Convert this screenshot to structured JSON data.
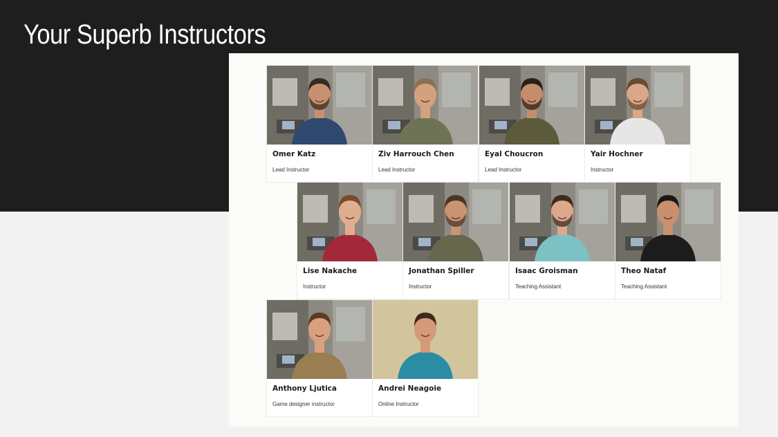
{
  "slide": {
    "title": "Your Superb Instructors"
  },
  "colors": {
    "dark_band": "#1e1e1e",
    "page_background": "#f2f2f2",
    "panel_background": "#fbfbf8",
    "name_text": "#1b1b1b"
  },
  "instructors": [
    {
      "name": "Omer Katz",
      "role": "Lead Instructor",
      "shirt": "#2f4a6e",
      "skin": "#c89072",
      "hair": "#3a2a1e",
      "beard": true,
      "sign": "Developers"
    },
    {
      "name": "Ziv Harrouch Chen",
      "role": "Lead Instructor",
      "shirt": "#6e7355",
      "skin": "#d4a17f",
      "hair": "#8a7152",
      "beard": false,
      "sign": "Developers"
    },
    {
      "name": "Eyal Choucron",
      "role": "Lead Instructor",
      "shirt": "#5b5a3a",
      "skin": "#c48e6c",
      "hair": "#2b1f17",
      "beard": true,
      "sign": "Developers"
    },
    {
      "name": "Yair Hochner",
      "role": "Instructor",
      "shirt": "#e6e6e6",
      "skin": "#d8a888",
      "hair": "#6b4a2f",
      "beard": true,
      "sign": "Developers"
    },
    {
      "name": "Lise Nakache",
      "role": "Instructor",
      "shirt": "#a3283a",
      "skin": "#e0ad8f",
      "hair": "#7a4a2a",
      "beard": false,
      "sign": "Developers"
    },
    {
      "name": "Jonathan Spiller",
      "role": "Instructor",
      "shirt": "#65684c",
      "skin": "#c99474",
      "hair": "#4b3624",
      "beard": true,
      "sign": "Developers"
    },
    {
      "name": "Isaac Groisman",
      "role": "Teaching Assistant",
      "shirt": "#7cc1c4",
      "skin": "#dca98a",
      "hair": "#3e2c1e",
      "beard": true,
      "sign": "Developers"
    },
    {
      "name": "Theo Nataf",
      "role": "Teaching Assistant",
      "shirt": "#1c1c1c",
      "skin": "#c89070",
      "hair": "#1e1612",
      "beard": false,
      "sign": "Developers"
    },
    {
      "name": "Anthony Ljutica",
      "role": "Game designer instructor",
      "shirt": "#9a7e52",
      "skin": "#d9a080",
      "hair": "#5a3b22",
      "beard": false,
      "sign": "Developers"
    },
    {
      "name": "Andrei Neagoie",
      "role": "Online Instructor",
      "shirt": "#2a8da3",
      "skin": "#d59a78",
      "hair": "#3a2a1e",
      "beard": false,
      "sign": ""
    }
  ]
}
